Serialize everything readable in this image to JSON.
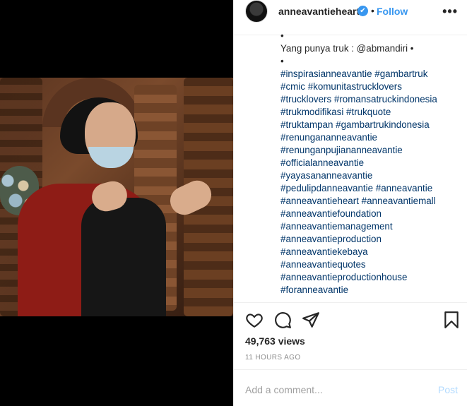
{
  "post": {
    "username": "anneavantieheart",
    "verified_mark": "✔",
    "separator": "•",
    "follow_label": "Follow",
    "more_label": "•••"
  },
  "caption": {
    "lines": [
      {
        "text": "•",
        "type": "text"
      },
      {
        "text": "Yang punya truk : @abmandiri •",
        "type": "text"
      },
      {
        "text": "•",
        "type": "text"
      },
      {
        "text": "#inspirasianneavantie #gambartruk",
        "type": "tag"
      },
      {
        "text": "#cmic #komunitastrucklovers",
        "type": "tag"
      },
      {
        "text": "#trucklovers #romansatruckindonesia",
        "type": "tag"
      },
      {
        "text": "#trukmodifikasi #trukquote",
        "type": "tag"
      },
      {
        "text": "#truktampan #gambartrukindonesia",
        "type": "tag"
      },
      {
        "text": "#renungananneavantie",
        "type": "tag"
      },
      {
        "text": "#renunganpujiananneavantie",
        "type": "tag"
      },
      {
        "text": "#officialanneavantie",
        "type": "tag"
      },
      {
        "text": "#yayasananneavantie",
        "type": "tag"
      },
      {
        "text": "#pedulipdanneavantie #anneavantie",
        "type": "tag"
      },
      {
        "text": "#anneavantieheart #anneavantiemall",
        "type": "tag"
      },
      {
        "text": "#anneavantiefoundation",
        "type": "tag"
      },
      {
        "text": "#anneavantiemanagement",
        "type": "tag"
      },
      {
        "text": "#anneavantieproduction",
        "type": "tag"
      },
      {
        "text": "#anneavantiekebaya",
        "type": "tag"
      },
      {
        "text": "#anneavantiequotes",
        "type": "tag"
      },
      {
        "text": "#anneavantieproductionhouse",
        "type": "tag"
      },
      {
        "text": "#foranneavantie",
        "type": "tag"
      }
    ]
  },
  "stats": {
    "views": "49,763 views",
    "time": "11 HOURS AGO"
  },
  "comment": {
    "placeholder": "Add a comment...",
    "post_label": "Post"
  },
  "icons": {
    "heart": "heart-icon",
    "comment": "comment-icon",
    "share": "share-icon",
    "save": "bookmark-icon",
    "more": "more-options-icon"
  },
  "colors": {
    "link": "#3897f0",
    "hashtag": "#003569",
    "post_disabled": "#b3dbff",
    "muted": "#8e8e8e"
  }
}
